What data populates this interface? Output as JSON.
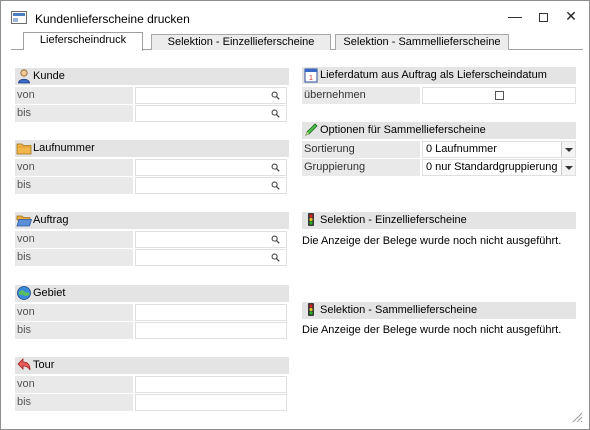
{
  "window": {
    "title": "Kundenlieferscheine drucken"
  },
  "tabs": [
    {
      "label": "Lieferscheindruck",
      "active": true
    },
    {
      "label": "Selektion - Einzellieferscheine",
      "active": false
    },
    {
      "label": "Selektion - Sammellieferscheine",
      "active": false
    }
  ],
  "left": {
    "kunde": {
      "title": "Kunde",
      "von": "von",
      "bis": "bis"
    },
    "laufnummer": {
      "title": "Laufnummer",
      "von": "von",
      "bis": "bis"
    },
    "auftrag": {
      "title": "Auftrag",
      "von": "von",
      "bis": "bis"
    },
    "gebiet": {
      "title": "Gebiet",
      "von": "von",
      "bis": "bis"
    },
    "tour": {
      "title": "Tour",
      "von": "von",
      "bis": "bis"
    }
  },
  "right": {
    "lieferdatum": {
      "title": "Lieferdatum aus Auftrag als Lieferscheindatum",
      "row_label": "übernehmen",
      "checked": false
    },
    "optionen": {
      "title": "Optionen für Sammellieferscheine",
      "sortierung_label": "Sortierung",
      "sortierung_value": "0  Laufnummer",
      "gruppierung_label": "Gruppierung",
      "gruppierung_value": "0  nur Standardgruppierung"
    },
    "einzel": {
      "title": "Selektion - Einzellieferscheine",
      "message": "Die Anzeige der Belege wurde noch nicht ausgeführt."
    },
    "sammel": {
      "title": "Selektion - Sammellieferscheine",
      "message": "Die Anzeige der Belege wurde noch nicht ausgeführt."
    }
  }
}
